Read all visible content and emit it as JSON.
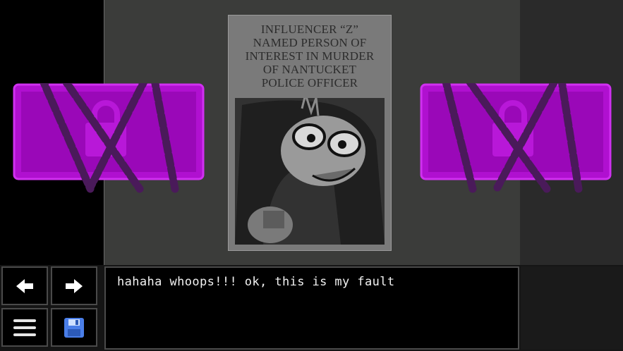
{
  "newspaper": {
    "headline": "INFLUENCER “Z”\nNAMED PERSON OF\nINTEREST IN MURDER\nOF NANTUCKET\nPOLICE OFFICER"
  },
  "dialogue": {
    "text": "hahaha whoops!!! ok, this is my fault"
  },
  "controls": {
    "back_icon": "left-arrow-icon",
    "forward_icon": "right-arrow-icon",
    "menu_icon": "hamburger-menu-icon",
    "save_icon": "floppy-disk-icon"
  },
  "colors": {
    "lock_purple": "#a010c0",
    "chain": "#4a1a5a",
    "save_blue": "#4a7ee8"
  }
}
